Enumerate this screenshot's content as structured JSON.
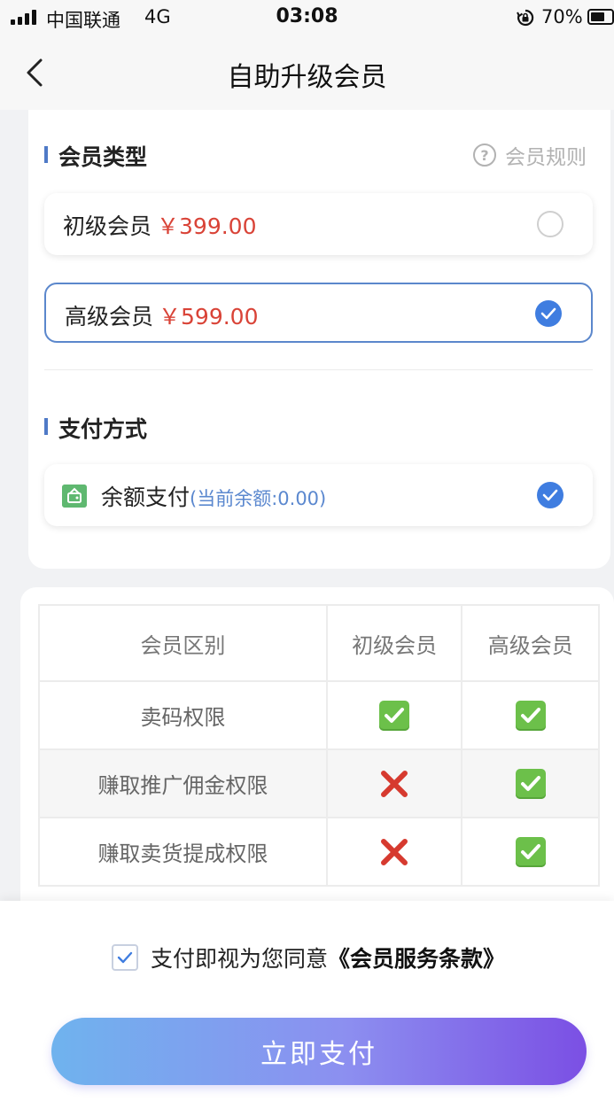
{
  "status_bar": {
    "carrier": "中国联通",
    "network": "4G",
    "time": "03:08",
    "battery_percent_label": "70%",
    "battery_level": 0.7,
    "icons": [
      "signal-icon",
      "rotation-lock-icon",
      "battery-icon"
    ]
  },
  "nav": {
    "title": "自助升级会员",
    "back_icon": "chevron-left-icon"
  },
  "member_type": {
    "section_title": "会员类型",
    "rules_label": "会员规则",
    "options": [
      {
        "name": "初级会员",
        "price": "￥399.00",
        "selected": false
      },
      {
        "name": "高级会员",
        "price": "￥599.00",
        "selected": true
      }
    ]
  },
  "payment": {
    "section_title": "支付方式",
    "method_name": "余额支付",
    "balance_note": "(当前余额:0.00)",
    "selected": true
  },
  "comparison": {
    "headers": [
      "会员区别",
      "初级会员",
      "高级会员"
    ],
    "rows": [
      {
        "feature": "卖码权限",
        "basic": true,
        "premium": true
      },
      {
        "feature": "赚取推广佣金权限",
        "basic": false,
        "premium": true
      },
      {
        "feature": "赚取卖货提成权限",
        "basic": false,
        "premium": true
      }
    ]
  },
  "agreement": {
    "checked": true,
    "text": "支付即视为您同意",
    "link": "《会员服务条款》"
  },
  "pay_button": {
    "label": "立即支付"
  },
  "colors": {
    "accent_blue": "#3f7de0",
    "price_red": "#d94337",
    "check_green": "#6cc04a",
    "cross_red": "#d63a2f"
  }
}
